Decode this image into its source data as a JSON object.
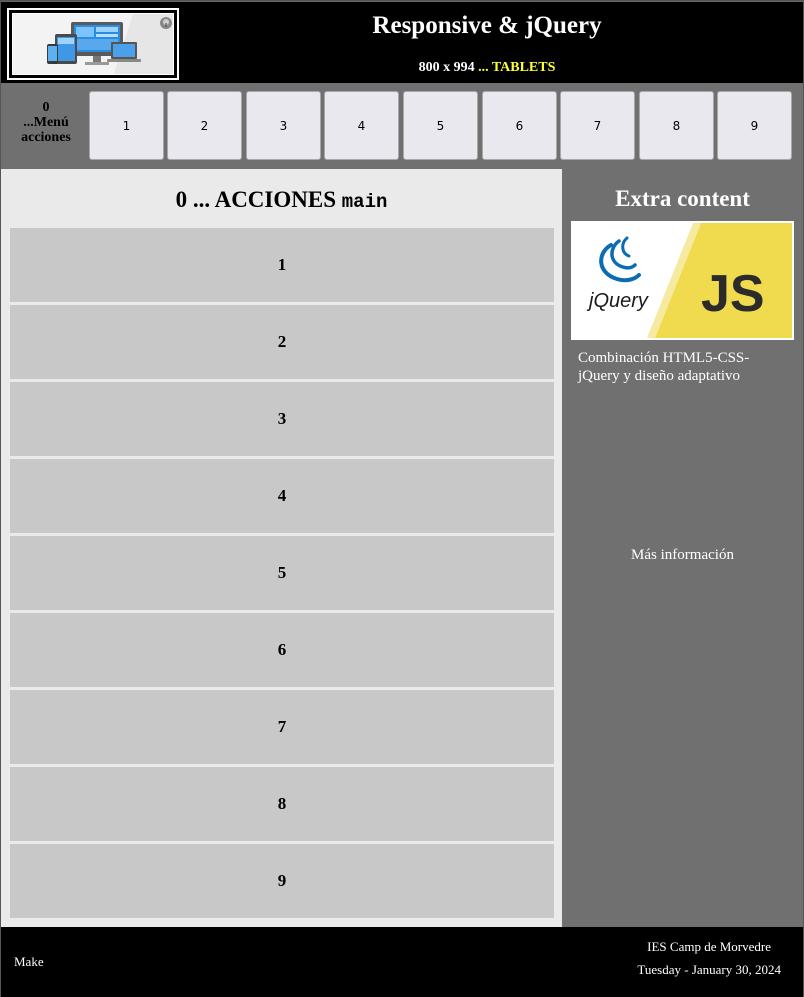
{
  "header": {
    "title": "Responsive & jQuery",
    "size_text": "800 x 994",
    "dots": "...",
    "device": "TABLETS",
    "logo_icon": "responsive-devices-icon"
  },
  "nav": {
    "label_line1": "0",
    "label_line2": "...Menú",
    "label_line3": "acciones",
    "buttons": [
      "1",
      "2",
      "3",
      "4",
      "5",
      "6",
      "7",
      "8",
      "9"
    ]
  },
  "main": {
    "title_prefix": "0 ... ACCIONES",
    "title_tag": "main",
    "actions": [
      "1",
      "2",
      "3",
      "4",
      "5",
      "6",
      "7",
      "8",
      "9"
    ]
  },
  "aside": {
    "title": "Extra content",
    "image_icon": "jquery-js-logo",
    "jquery_text": "jQuery",
    "js_text": "JS",
    "description": "Combinación HTML5-CSS-jQuery y diseño adaptativo",
    "more": "Más información"
  },
  "footer": {
    "left": "Make",
    "school": "IES Camp de Morvedre",
    "date": "Tuesday - January 30, 2024"
  },
  "colors": {
    "accent_yellow": "#ffff33",
    "header_bg": "#000000",
    "nav_bg": "#707070",
    "main_bg": "#eaeaea",
    "action_bg": "#c8c8c8",
    "js_yellow": "#f0db4f"
  }
}
